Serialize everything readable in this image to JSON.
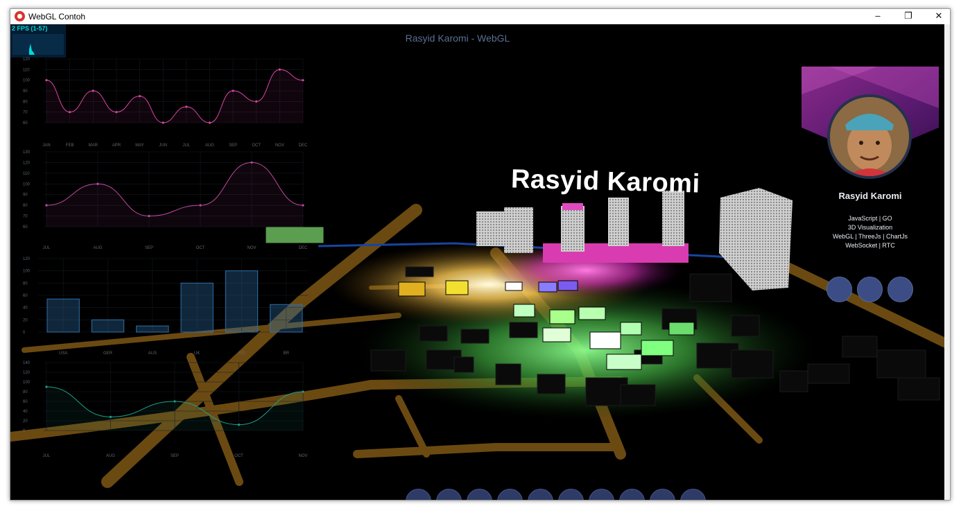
{
  "window": {
    "title": "WebGL Contoh",
    "controls": {
      "minimize": "–",
      "maximize": "❐",
      "close": "✕"
    }
  },
  "page": {
    "header": "Rasyid Karomi - WebGL",
    "scene_title": "Rasyid Karomi"
  },
  "fps": {
    "text": "2 FPS (1-57)",
    "value": 2,
    "min": 1,
    "max": 57
  },
  "profile": {
    "name": "Rasyid Karomi",
    "skills": [
      "JavaScript | GO",
      "3D Visualization",
      "WebGL | ThreeJs | ChartJs",
      "WebSocket | RTC"
    ],
    "social_buttons": [
      {
        "icon": "social-icon-1"
      },
      {
        "icon": "social-icon-2"
      },
      {
        "icon": "social-icon-3"
      }
    ]
  },
  "nav_dots_count": 10,
  "colors": {
    "accent_pink": "#d946a5",
    "accent_blue": "#3b4d84",
    "road": "#6b4a12",
    "green_glow": "#6dff6d"
  },
  "chart_data": [
    {
      "type": "line",
      "categories": [
        "JAN",
        "FEB",
        "MAR",
        "APR",
        "MAY",
        "JUN",
        "JUL",
        "AUG",
        "SEP",
        "OCT",
        "NOV",
        "DEC"
      ],
      "series": [
        {
          "values": [
            100,
            70,
            90,
            70,
            85,
            60,
            75,
            60,
            90,
            80,
            110,
            100
          ]
        }
      ],
      "ylim": [
        60,
        120
      ],
      "yticks": [
        60,
        70,
        80,
        90,
        100,
        110,
        120
      ],
      "color": "#d946a5"
    },
    {
      "type": "line",
      "categories": [
        "JUL",
        "AUG",
        "SEP",
        "OCT",
        "NOV",
        "DEC"
      ],
      "series": [
        {
          "values": [
            80,
            100,
            70,
            80,
            120,
            80
          ]
        }
      ],
      "ylim": [
        60,
        130
      ],
      "yticks": [
        60,
        70,
        80,
        90,
        100,
        110,
        120,
        130
      ],
      "color": "#c04aa0"
    },
    {
      "type": "bar",
      "categories": [
        "USA",
        "GER",
        "AUS",
        "UK",
        "RO",
        "BR"
      ],
      "values": [
        54,
        20,
        10,
        80,
        100,
        45
      ],
      "ylim": [
        0,
        120
      ],
      "yticks": [
        0,
        20,
        40,
        60,
        80,
        100,
        120
      ],
      "color": "#2f6fa8"
    },
    {
      "type": "line",
      "categories": [
        "JUL",
        "AUG",
        "SEP",
        "OCT",
        "NOV"
      ],
      "series": [
        {
          "values": [
            90,
            28,
            60,
            12,
            80
          ]
        }
      ],
      "ylim": [
        0,
        140
      ],
      "yticks": [
        0,
        20,
        40,
        60,
        80,
        100,
        120,
        140
      ],
      "color": "#1f9e88"
    }
  ]
}
